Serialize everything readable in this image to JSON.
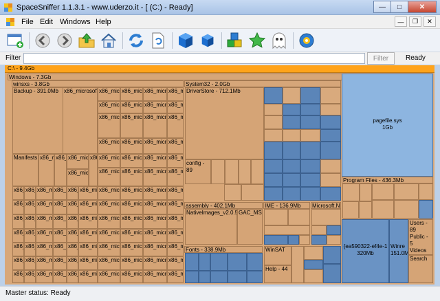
{
  "window": {
    "title": "SpaceSniffer 1.1.3.1 - www.uderzo.it - [ (C:) - Ready]"
  },
  "menu": {
    "items": [
      "File",
      "Edit",
      "Windows",
      "Help"
    ]
  },
  "toolbar": {
    "icons": [
      "new-window-icon",
      "back-icon",
      "forward-icon",
      "up-folder-icon",
      "home-icon",
      "refresh-icon",
      "document-icon",
      "cube-blue-icon",
      "cube-blue-small-icon",
      "blocks-icon",
      "star-icon",
      "ghost-icon",
      "gear-icon"
    ]
  },
  "filter": {
    "label": "Filter",
    "value": "",
    "button": "Filter",
    "status": "Ready"
  },
  "map": {
    "drive": "C:\\ - 9.4Gb",
    "windows": "Windows - 7.3Gb",
    "winsxs": "winsxs - 3.8Gb",
    "backup": "Backup - 391.0Mb",
    "x86ms": "x86_microsoft-",
    "manifests": "Manifests",
    "system32": "System32 - 2.0Gb",
    "driverstore": "DriverStore - 712.1Mb",
    "pagefile": "pagefile.sys",
    "pagefile_size": "1Gb",
    "programfiles": "Program Files - 436.3Mb",
    "assembly": "assembly - 402.1Mb",
    "nativeimages": "NativeImages_v2.0.5",
    "gacms": "GAC_MS",
    "ime": "IME - 136.9Mb",
    "microsoftnet": "Microsoft.NE",
    "fonts": "Fonts - 338.9Mb",
    "config": "config - 89",
    "users": "Users - 89",
    "winsat": "WinSAT",
    "help": "Help - 44",
    "ea": "{ea590322-ef4e-1",
    "ea_size": "320Mb",
    "winre": "Winre",
    "winre_size": "151.0M",
    "search": "Search",
    "public": "Public - 5",
    "videos": "Videos"
  },
  "status": {
    "text": "Master status: Ready"
  }
}
